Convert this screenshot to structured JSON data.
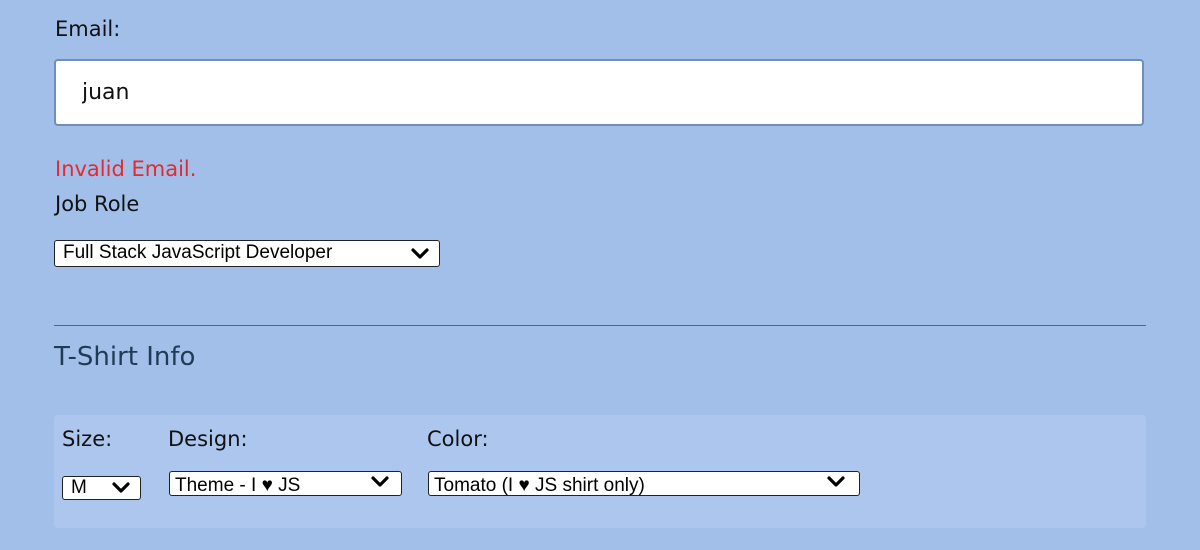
{
  "basic_info": {
    "email_label": "Email:",
    "email_value": "juan",
    "error_text": "Invalid Email.",
    "job_role_label": "Job Role",
    "job_role_selected": "Full Stack JavaScript Developer"
  },
  "tshirt": {
    "section_title": "T-Shirt Info",
    "size_label": "Size:",
    "size_selected": "M",
    "design_label": "Design:",
    "design_selected": "Theme - I ♥ JS",
    "color_label": "Color:",
    "color_selected": "Tomato (I ♥ JS shirt only)"
  },
  "icons": {
    "select_arrow": "chevron-down-icon"
  },
  "colors": {
    "background": "#a2bfe9",
    "panel": "#adc6ee",
    "error": "#e8282b",
    "section_title": "#1f3b56",
    "divider": "#4a6784"
  }
}
